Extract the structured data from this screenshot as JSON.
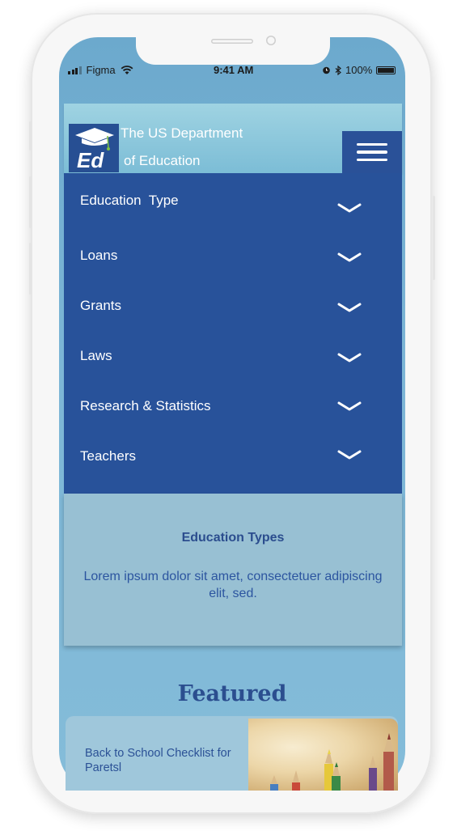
{
  "status_bar": {
    "carrier": "Figma",
    "time": "9:41 AM",
    "battery": "100%"
  },
  "header": {
    "logo_text": "Ed",
    "title_line1": "The US Department",
    "title_line2": "of Education"
  },
  "nav": {
    "items": [
      {
        "label": "Education  Type"
      },
      {
        "label": "Loans"
      },
      {
        "label": "Grants"
      },
      {
        "label": "Laws"
      },
      {
        "label": "Research & Statistics"
      },
      {
        "label": "Teachers"
      }
    ]
  },
  "info_card": {
    "title": "Education Types",
    "body": "Lorem ipsum dolor sit amet, consectetuer adipiscing elit, sed."
  },
  "featured": {
    "heading": "Featured",
    "card_text": "Back to School Checklist for Paretsl"
  },
  "colors": {
    "nav_bg": "#28529a",
    "screen_bg": "#7db6d6",
    "accent_text": "#2b4e8f",
    "logo_accent": "#7dc242"
  }
}
